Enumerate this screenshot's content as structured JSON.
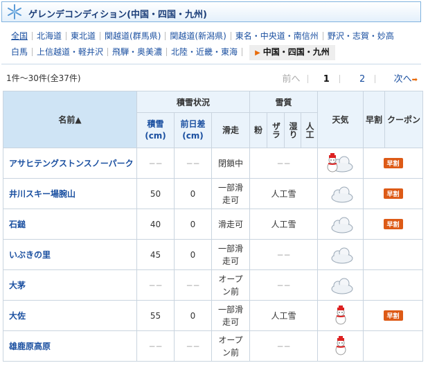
{
  "header": {
    "title": "ゲレンデコンディション(中国・四国・九州)"
  },
  "nav": {
    "row1": [
      "全国",
      "北海道",
      "東北道",
      "関越道(群馬県)",
      "関越道(新潟県)",
      "東名・中央道・南信州",
      "野沢・志賀・妙高"
    ],
    "row2": [
      "白馬",
      "上信越道・軽井沢",
      "飛騨・奥美濃",
      "北陸・近畿・東海"
    ],
    "active": "中国・四国・九州"
  },
  "pager": {
    "count": "1件～30件(全37件)",
    "prev": "前へ",
    "page1": "1",
    "page2": "2",
    "next": "次へ"
  },
  "table": {
    "headers": {
      "name": "名前▲",
      "snow_status": "積雪状況",
      "quality": "雪質",
      "weather": "天気",
      "early": "早割",
      "coupon": "クーポン",
      "depth": "積雪\n(cm)",
      "diff": "前日差\n(cm)",
      "slope": "滑走",
      "powder": "粉",
      "zara": "ザラ",
      "wet": "湿り",
      "artificial": "人工"
    },
    "rows": [
      {
        "name": "アサヒテングストンスノーパーク",
        "depth": "−−",
        "diff": "−−",
        "slope": "閉鎖中",
        "quality": "−−",
        "weather": "snowman-cloud",
        "early": "早割"
      },
      {
        "name": "井川スキー場腕山",
        "depth": "50",
        "diff": "0",
        "slope": "一部滑\n走可",
        "quality": "人工雪",
        "weather": "cloud",
        "early": "早割"
      },
      {
        "name": "石鎚",
        "depth": "40",
        "diff": "0",
        "slope": "滑走可",
        "quality": "人工雪",
        "weather": "cloud",
        "early": "早割"
      },
      {
        "name": "いぶきの里",
        "depth": "45",
        "diff": "0",
        "slope": "一部滑\n走可",
        "quality": "−−",
        "weather": "cloud",
        "early": ""
      },
      {
        "name": "大茅",
        "depth": "−−",
        "diff": "−−",
        "slope": "オープ\nン前",
        "quality": "−−",
        "weather": "cloud",
        "early": ""
      },
      {
        "name": "大佐",
        "depth": "55",
        "diff": "0",
        "slope": "一部滑\n走可",
        "quality": "人工雪",
        "weather": "snowman",
        "early": "早割"
      },
      {
        "name": "雄鹿原高原",
        "depth": "−−",
        "diff": "−−",
        "slope": "オープ\nン前",
        "quality": "−−",
        "weather": "snowman",
        "early": ""
      }
    ]
  }
}
